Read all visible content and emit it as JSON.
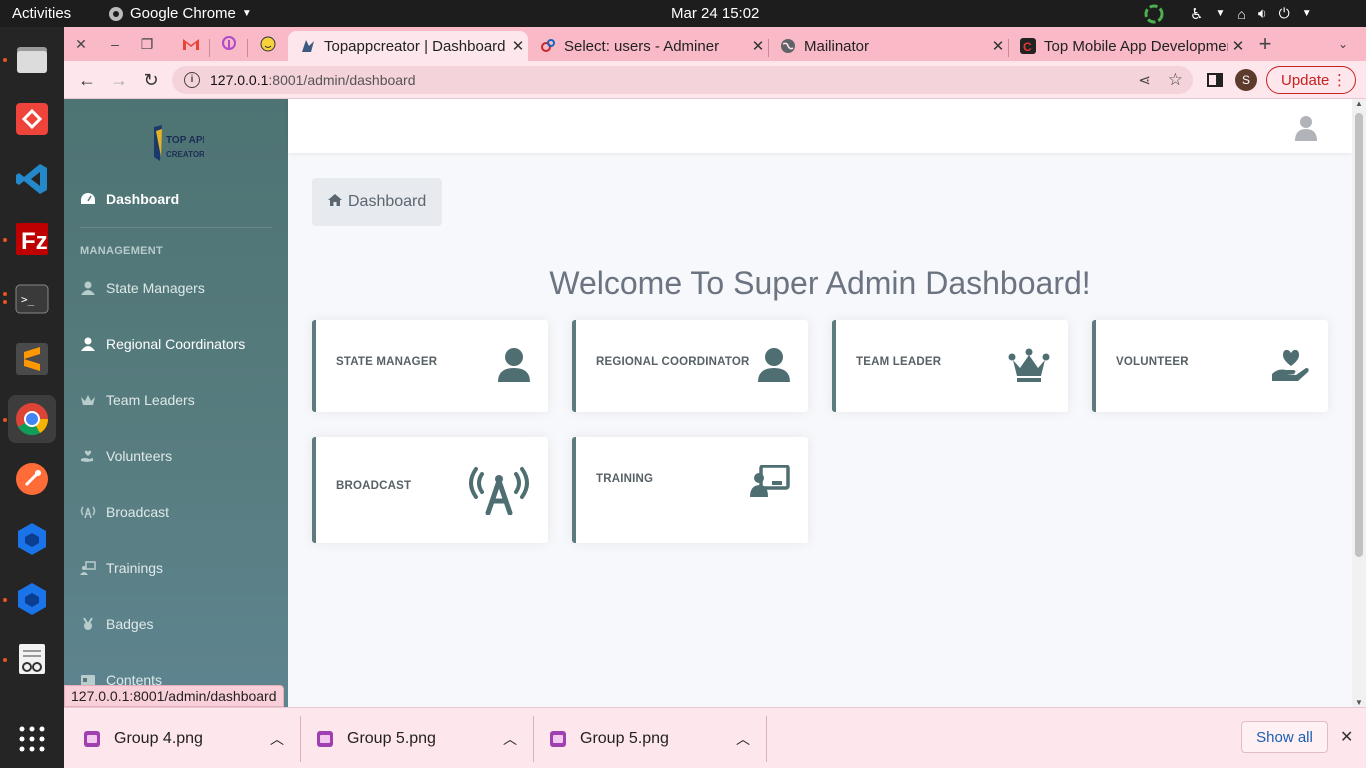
{
  "topbar": {
    "activities": "Activities",
    "app_name": "Google Chrome",
    "clock": "Mar 24  15:02"
  },
  "tabs": [
    {
      "title": "Topappcreator | Dashboard",
      "active": true
    },
    {
      "title": "Select: users - Adminer",
      "active": false
    },
    {
      "title": "Mailinator",
      "active": false
    },
    {
      "title": "Top Mobile App Development",
      "active": false
    }
  ],
  "toolbar": {
    "url_host": "127.0.0.1",
    "url_rest": ":8001/admin/dashboard",
    "profile_initial": "S",
    "update_label": "Update"
  },
  "sidebar": {
    "logo_text": [
      "TOP APP",
      "CREATORS"
    ],
    "dashboard": "Dashboard",
    "section_heading": "MANAGEMENT",
    "items": [
      {
        "label": "State Managers",
        "icon": "user-icon"
      },
      {
        "label": "Regional Coordinators",
        "icon": "user-icon"
      },
      {
        "label": "Team Leaders",
        "icon": "crown-icon"
      },
      {
        "label": "Volunteers",
        "icon": "hand-heart-icon"
      },
      {
        "label": "Broadcast",
        "icon": "broadcast-icon"
      },
      {
        "label": "Trainings",
        "icon": "chalkboard-user-icon"
      },
      {
        "label": "Badges",
        "icon": "medal-icon"
      },
      {
        "label": "Contents",
        "icon": "id-card-icon"
      }
    ]
  },
  "main": {
    "breadcrumb": "Dashboard",
    "welcome": "Welcome To Super Admin Dashboard!",
    "cards": [
      {
        "label": "STATE MANAGER",
        "icon": "user-icon"
      },
      {
        "label": "REGIONAL COORDINATOR",
        "icon": "user-icon"
      },
      {
        "label": "TEAM LEADER",
        "icon": "crown-icon"
      },
      {
        "label": "VOLUNTEER",
        "icon": "hand-heart-icon"
      },
      {
        "label": "BROADCAST",
        "icon": "broadcast-icon"
      },
      {
        "label": "TRAINING",
        "icon": "chalkboard-user-icon"
      }
    ]
  },
  "status_url": "127.0.0.1:8001/admin/dashboard",
  "downloads": {
    "items": [
      "Group 4.png",
      "Group 5.png",
      "Group 5.png"
    ],
    "show_all": "Show all"
  },
  "colors": {
    "sidebar": "#557a7c",
    "card_accent": "#5b7b7f",
    "icon": "#4f6e72",
    "tab_strip": "#f9b9c7",
    "update": "#c5221f"
  }
}
